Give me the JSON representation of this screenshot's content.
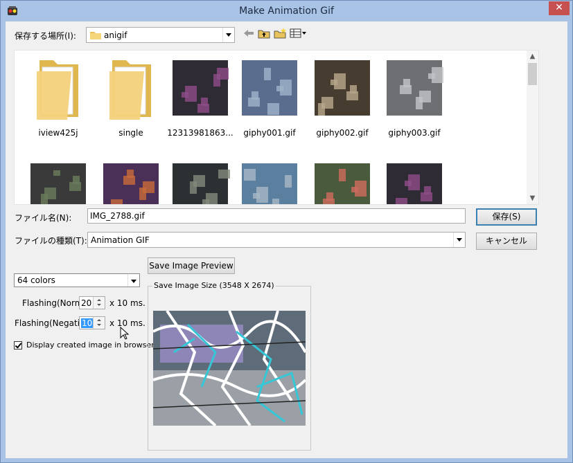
{
  "window": {
    "title": "Make Animation Gif",
    "close_glyph": "✕",
    "app_icon": "app-icon"
  },
  "location": {
    "label": "保存する場所(I):",
    "value": "anigif"
  },
  "toolbar": {
    "icons": [
      "back-arrow-icon",
      "up-folder-icon",
      "new-folder-icon",
      "view-menu-icon"
    ]
  },
  "files": [
    {
      "name": "iview425j",
      "kind": "folder"
    },
    {
      "name": "single",
      "kind": "folder"
    },
    {
      "name": "12313981863...",
      "kind": "image"
    },
    {
      "name": "giphy001.gif",
      "kind": "image"
    },
    {
      "name": "giphy002.gif",
      "kind": "image"
    },
    {
      "name": "giphy003.gif",
      "kind": "image"
    },
    {
      "name": "",
      "kind": "image"
    },
    {
      "name": "",
      "kind": "image"
    },
    {
      "name": "",
      "kind": "image"
    },
    {
      "name": "",
      "kind": "image"
    },
    {
      "name": "",
      "kind": "image"
    },
    {
      "name": "",
      "kind": "image"
    }
  ],
  "filename": {
    "label": "ファイル名(N):",
    "value": "IMG_2788.gif"
  },
  "filetype": {
    "label": "ファイルの種類(T):",
    "value": "Animation GIF"
  },
  "buttons": {
    "save": "保存(S)",
    "cancel": "キャンセル",
    "preview": "Save Image Preview"
  },
  "options": {
    "colors": "64 colors",
    "flash_normal_label": "Flashing(Normal)",
    "flash_normal_value": "20",
    "flash_negative_label": "Flashing(Negative)",
    "flash_negative_value": "10",
    "unit": "x 10 ms.",
    "browser_check_label": "Display created image in browser",
    "browser_checked": true
  },
  "save_size": {
    "title": "Save Image Size (3548 X 2674)"
  },
  "colors": {
    "titlebar": "#a9c3e6",
    "close": "#c75050",
    "default_border": "#3c7fb1",
    "selection": "#3399ff"
  }
}
